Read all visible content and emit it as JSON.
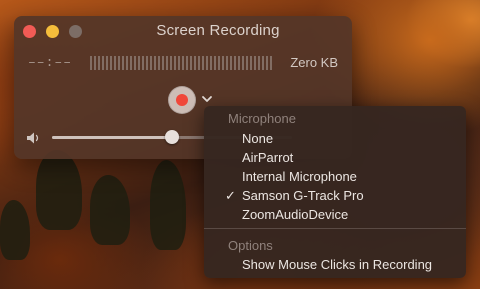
{
  "window": {
    "title": "Screen Recording",
    "elapsed_time": "––:––",
    "file_size": "Zero KB",
    "volume_level": 0.5
  },
  "menu": {
    "microphone_header": "Microphone",
    "microphones": [
      {
        "label": "None",
        "checked": false
      },
      {
        "label": "AirParrot",
        "checked": false
      },
      {
        "label": "Internal Microphone",
        "checked": false
      },
      {
        "label": "Samson G-Track Pro",
        "checked": true
      },
      {
        "label": "ZoomAudioDevice",
        "checked": false
      }
    ],
    "check_glyph": "✓",
    "options_header": "Options",
    "options": [
      {
        "label": "Show Mouse Clicks in Recording"
      }
    ]
  },
  "colors": {
    "record": "#f0473a",
    "close": "#f25b55",
    "minimize": "#f5bd3b"
  }
}
